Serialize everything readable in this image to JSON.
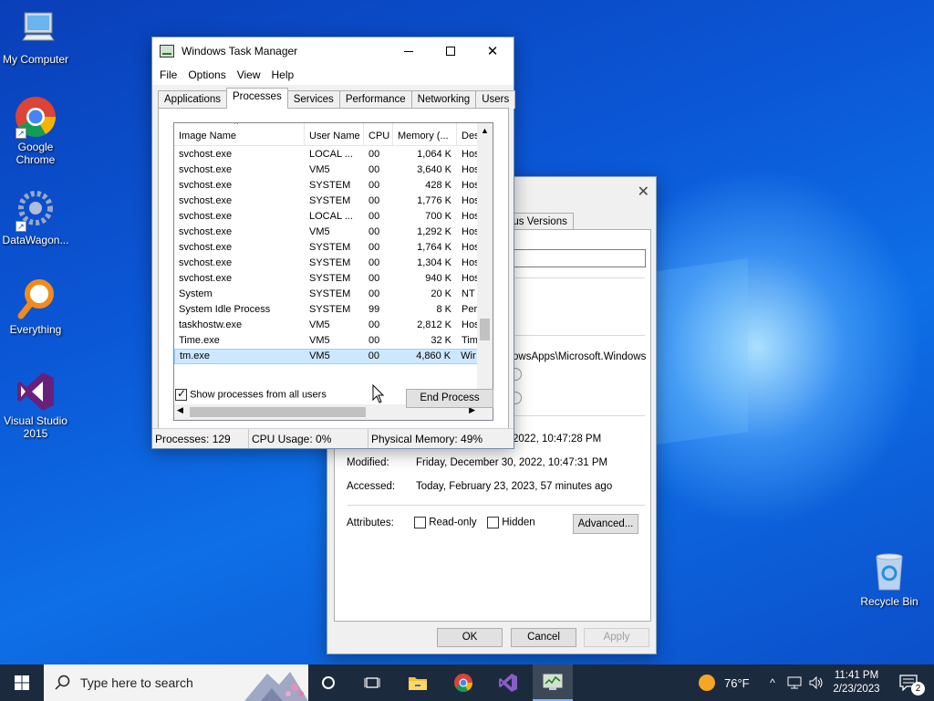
{
  "desktop": {
    "icons": [
      {
        "label": "My Computer",
        "icon": "computer-icon"
      },
      {
        "label": "Google Chrome",
        "icon": "chrome-icon"
      },
      {
        "label": "DataWagon...",
        "icon": "datawagon-icon"
      },
      {
        "label": "Everything",
        "icon": "everything-search-icon"
      },
      {
        "label": "Visual Studio 2015",
        "icon": "visual-studio-icon"
      },
      {
        "label": "Recycle Bin",
        "icon": "recycle-bin-icon"
      }
    ]
  },
  "task_manager": {
    "title": "Windows Task Manager",
    "menu": [
      "File",
      "Options",
      "View",
      "Help"
    ],
    "tabs": [
      "Applications",
      "Processes",
      "Services",
      "Performance",
      "Networking",
      "Users"
    ],
    "active_tab": "Processes",
    "columns": [
      "Image Name",
      "User Name",
      "CPU",
      "Memory (...",
      "Des"
    ],
    "rows": [
      {
        "image": "svchost.exe",
        "user": "LOCAL ...",
        "cpu": "00",
        "mem": "1,064 K",
        "desc": "Hos"
      },
      {
        "image": "svchost.exe",
        "user": "VM5",
        "cpu": "00",
        "mem": "3,640 K",
        "desc": "Hos"
      },
      {
        "image": "svchost.exe",
        "user": "SYSTEM",
        "cpu": "00",
        "mem": "428 K",
        "desc": "Hos"
      },
      {
        "image": "svchost.exe",
        "user": "SYSTEM",
        "cpu": "00",
        "mem": "1,776 K",
        "desc": "Hos"
      },
      {
        "image": "svchost.exe",
        "user": "LOCAL ...",
        "cpu": "00",
        "mem": "700 K",
        "desc": "Hos"
      },
      {
        "image": "svchost.exe",
        "user": "VM5",
        "cpu": "00",
        "mem": "1,292 K",
        "desc": "Hos"
      },
      {
        "image": "svchost.exe",
        "user": "SYSTEM",
        "cpu": "00",
        "mem": "1,764 K",
        "desc": "Hos"
      },
      {
        "image": "svchost.exe",
        "user": "SYSTEM",
        "cpu": "00",
        "mem": "1,304 K",
        "desc": "Hos"
      },
      {
        "image": "svchost.exe",
        "user": "SYSTEM",
        "cpu": "00",
        "mem": "940 K",
        "desc": "Hos"
      },
      {
        "image": "System",
        "user": "SYSTEM",
        "cpu": "00",
        "mem": "20 K",
        "desc": "NT"
      },
      {
        "image": "System Idle Process",
        "user": "SYSTEM",
        "cpu": "99",
        "mem": "8 K",
        "desc": "Per"
      },
      {
        "image": "taskhostw.exe",
        "user": "VM5",
        "cpu": "00",
        "mem": "2,812 K",
        "desc": "Hos"
      },
      {
        "image": "Time.exe",
        "user": "VM5",
        "cpu": "00",
        "mem": "32 K",
        "desc": "Tim"
      },
      {
        "image": "tm.exe",
        "user": "VM5",
        "cpu": "00",
        "mem": "4,860 K",
        "desc": "Wir"
      }
    ],
    "selected_row": "tm.exe",
    "show_all_label": "Show processes from all users",
    "show_all_checked": true,
    "end_process_label": "End Process",
    "status": {
      "processes": "Processes: 129",
      "cpu": "CPU Usage: 0%",
      "memory": "Physical Memory: 49%"
    }
  },
  "properties": {
    "tab_partial": "ous Versions",
    "location_partial": "owsApps\\Microsoft.Windows",
    "created_partial": "2022, 10:47:28 PM",
    "modified_label": "Modified:",
    "modified_value": "Friday, December 30, 2022, 10:47:31 PM",
    "accessed_label": "Accessed:",
    "accessed_value": "Today, February 23, 2023, 57 minutes ago",
    "attributes_label": "Attributes:",
    "readonly_label": "Read-only",
    "hidden_label": "Hidden",
    "advanced_label": "Advanced...",
    "ok_label": "OK",
    "cancel_label": "Cancel",
    "apply_label": "Apply"
  },
  "taskbar": {
    "search_placeholder": "Type here to search",
    "weather": "76°F",
    "time": "11:41 PM",
    "date": "2/23/2023",
    "notification_count": "2"
  }
}
